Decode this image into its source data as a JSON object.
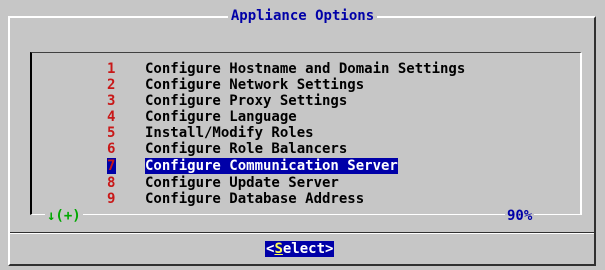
{
  "dialog": {
    "title": "Appliance Options"
  },
  "menu": {
    "items": [
      {
        "number": "1",
        "label": "Configure Hostname and Domain Settings",
        "selected": false
      },
      {
        "number": "2",
        "label": "Configure Network Settings",
        "selected": false
      },
      {
        "number": "3",
        "label": "Configure Proxy Settings",
        "selected": false
      },
      {
        "number": "4",
        "label": "Configure Language",
        "selected": false
      },
      {
        "number": "5",
        "label": "Install/Modify Roles",
        "selected": false
      },
      {
        "number": "6",
        "label": "Configure Role Balancers",
        "selected": false
      },
      {
        "number": "7",
        "label": "Configure Communication Server",
        "selected": true
      },
      {
        "number": "8",
        "label": "Configure Update Server",
        "selected": false
      },
      {
        "number": "9",
        "label": "Configure Database Address",
        "selected": false
      }
    ],
    "scroll_indicator": "↓(+)",
    "scroll_percent": "90%"
  },
  "buttons": {
    "select_open": "<",
    "select_hotkey": "S",
    "select_rest": "elect",
    "select_close": ">"
  },
  "colors": {
    "background": "#c6c6c6",
    "title": "#0000a8",
    "number": "#c81818",
    "selection": "#0000a8",
    "scroll_indicator": "#00a800",
    "hotkey": "#ffff55"
  }
}
